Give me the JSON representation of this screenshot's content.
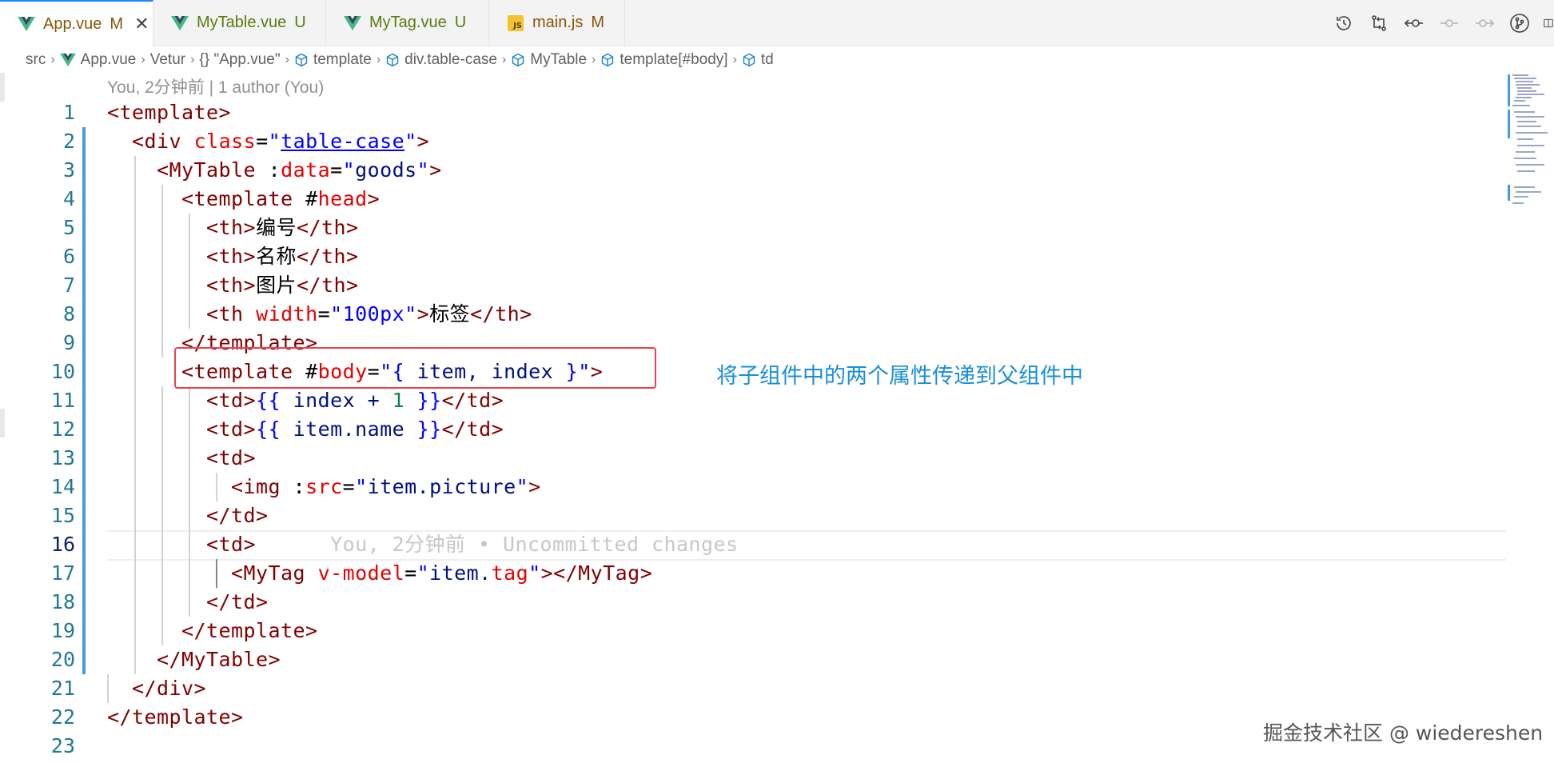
{
  "tabs": [
    {
      "name": "App.vue",
      "status": "M",
      "icon": "vue-icon",
      "active": true,
      "status_color": "#895503"
    },
    {
      "name": "MyTable.vue",
      "status": "U",
      "icon": "vue-icon",
      "active": false,
      "status_color": "#587c0c"
    },
    {
      "name": "MyTag.vue",
      "status": "U",
      "icon": "vue-icon",
      "active": false,
      "status_color": "#587c0c"
    },
    {
      "name": "main.js",
      "status": "M",
      "icon": "js-icon",
      "active": false,
      "status_color": "#895503"
    }
  ],
  "js_badge": "JS",
  "toolbar": [
    "timeline-icon",
    "compare-changes-icon",
    "previous-change-icon",
    "current-change-icon",
    "next-change-icon",
    "source-control-icon",
    "split-editor-icon"
  ],
  "breadcrumb": [
    "src",
    "App.vue",
    "Vetur",
    "{} \"App.vue\"",
    "template",
    "div.table-case",
    "MyTable",
    "template[#body]",
    "td"
  ],
  "codelens": "You, 2分钟前 | 1 author (You)",
  "current_line": 16,
  "lines": [
    {
      "n": "1"
    },
    {
      "n": "2"
    },
    {
      "n": "3"
    },
    {
      "n": "4"
    },
    {
      "n": "5"
    },
    {
      "n": "6"
    },
    {
      "n": "7"
    },
    {
      "n": "8"
    },
    {
      "n": "9"
    },
    {
      "n": "10"
    },
    {
      "n": "11"
    },
    {
      "n": "12"
    },
    {
      "n": "13"
    },
    {
      "n": "14"
    },
    {
      "n": "15"
    },
    {
      "n": "16"
    },
    {
      "n": "17"
    },
    {
      "n": "18"
    },
    {
      "n": "19"
    },
    {
      "n": "20"
    },
    {
      "n": "21"
    },
    {
      "n": "22"
    },
    {
      "n": "23"
    }
  ],
  "code": {
    "l1_tag": "template",
    "l2_tag": "div",
    "l2_attr": "class",
    "l2_val": "table-case",
    "l3_tag": "MyTable",
    "l3_attr_colon": ":",
    "l3_attr": "data",
    "l3_val": "goods",
    "l4_tag": "template",
    "l4_hash": "#",
    "l4_slot": "head",
    "l5_text": "编号",
    "l6_text": "名称",
    "l7_text": "图片",
    "l8_attr": "width",
    "l8_val": "100px",
    "l8_text": "标签",
    "l9_tag": "template",
    "l10_tag": "template",
    "l10_slot": "body",
    "l10_open": "{",
    "l10_val": " item, index ",
    "l10_close": "}",
    "l11_open": "{{",
    "l11_expr": " index + ",
    "l11_num": "1",
    "l11_close": " }}",
    "l12_open": "{{",
    "l12_expr": " item.name ",
    "l12_close": "}}",
    "l14_tag": "img",
    "l14_attr": "src",
    "l14_val": "item.picture",
    "l16_ghost": "You, 2分钟前 • Uncommitted changes",
    "l17_tag": "MyTag",
    "l17_attr": "v-model",
    "l17_val_a": "item.",
    "l17_val_b": "tag",
    "l20_tag": "MyTable",
    "l21_tag": "div",
    "l22_tag": "template",
    "th": "th",
    "td": "td"
  },
  "annotation": "将子组件中的两个属性传递到父组件中",
  "watermark": "掘金技术社区 @ wiedereshen"
}
